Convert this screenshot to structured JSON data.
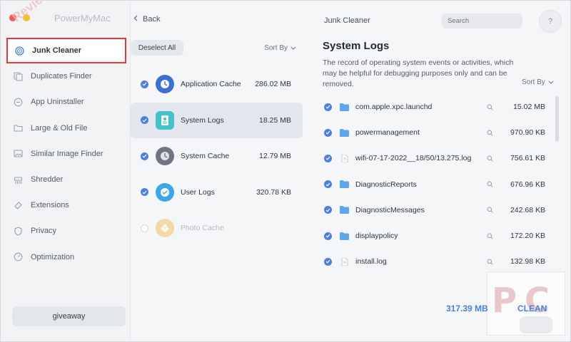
{
  "app": {
    "title": "PowerMyMac",
    "watermark": "Reviews PC"
  },
  "sidebar": {
    "items": [
      {
        "label": "Junk Cleaner",
        "icon": "junk-cleaner-icon",
        "active": true
      },
      {
        "label": "Duplicates Finder",
        "icon": "duplicates-icon"
      },
      {
        "label": "App Uninstaller",
        "icon": "app-uninstaller-icon"
      },
      {
        "label": "Large & Old File",
        "icon": "large-file-icon"
      },
      {
        "label": "Similar Image Finder",
        "icon": "image-icon"
      },
      {
        "label": "Shredder",
        "icon": "shredder-icon"
      },
      {
        "label": "Extensions",
        "icon": "extensions-icon"
      },
      {
        "label": "Privacy",
        "icon": "privacy-icon"
      },
      {
        "label": "Optimization",
        "icon": "optimization-icon"
      }
    ],
    "giveaway_label": "giveaway"
  },
  "middle": {
    "back_label": "Back",
    "deselect_label": "Deselect All",
    "sort_label": "Sort By",
    "categories": [
      {
        "name": "Application Cache",
        "size": "286.02 MB",
        "checked": true,
        "color": "#3b6fd8"
      },
      {
        "name": "System Logs",
        "size": "18.25 MB",
        "checked": true,
        "color": "#46c1c9"
      },
      {
        "name": "System Cache",
        "size": "12.79 MB",
        "checked": true,
        "color": "#6f7583"
      },
      {
        "name": "User Logs",
        "size": "320.78 KB",
        "checked": true,
        "color": "#3aa7e8"
      },
      {
        "name": "Photo Cache",
        "size": "",
        "checked": false,
        "color": "#f3d9a8"
      }
    ]
  },
  "right": {
    "header_title": "Junk Cleaner",
    "search_placeholder": "Search",
    "help_label": "?",
    "section_title": "System Logs",
    "description": "The record of operating system events or activities, which may be helpful for debugging purposes only and can be removed.",
    "sort_label": "Sort By",
    "files": [
      {
        "name": "com.apple.xpc.launchd",
        "size": "15.02 MB",
        "type": "folder"
      },
      {
        "name": "powermanagement",
        "size": "970.90 KB",
        "type": "folder"
      },
      {
        "name": "wifi-07-17-2022__18/50/13.275.log",
        "size": "756.61 KB",
        "type": "file"
      },
      {
        "name": "DiagnosticReports",
        "size": "676.96 KB",
        "type": "folder"
      },
      {
        "name": "DiagnosticMessages",
        "size": "242.68 KB",
        "type": "folder"
      },
      {
        "name": "displaypolicy",
        "size": "172.20 KB",
        "type": "folder"
      },
      {
        "name": "install.log",
        "size": "132.98 KB",
        "type": "file"
      }
    ],
    "total_size": "317.39 MB",
    "clean_label": "CLEAN",
    "pc_logo_text": [
      "P",
      "C"
    ]
  },
  "colors": {
    "accent": "#4d7fe0",
    "highlight_border": "#e23b3b"
  }
}
